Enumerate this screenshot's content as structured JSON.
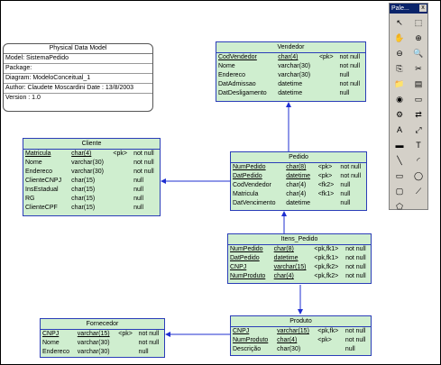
{
  "model_box": {
    "title": "Physical Data Model",
    "rows": [
      "Model: SistemaPedido",
      "Package:",
      "Diagram: ModeloConceitual_1",
      "Author: Claudete Moscardini   Date : 13/8/2003",
      "Version : 1.0"
    ]
  },
  "palette": {
    "title": "Pale...",
    "close": "x",
    "tools": [
      {
        "name": "pointer-icon",
        "glyph": "↖"
      },
      {
        "name": "select-area-icon",
        "glyph": "⬚"
      },
      {
        "name": "hand-icon",
        "glyph": "✋"
      },
      {
        "name": "zoom-in-icon",
        "glyph": "⊕"
      },
      {
        "name": "zoom-out-icon",
        "glyph": "⊖"
      },
      {
        "name": "zoom-fit-icon",
        "glyph": "🔍"
      },
      {
        "name": "copy-icon",
        "glyph": "⎘"
      },
      {
        "name": "cut-icon",
        "glyph": "✂"
      },
      {
        "name": "package-icon",
        "glyph": "📁"
      },
      {
        "name": "table-icon",
        "glyph": "▤"
      },
      {
        "name": "view-icon",
        "glyph": "◉"
      },
      {
        "name": "procedure-icon",
        "glyph": "▭"
      },
      {
        "name": "gear-icon",
        "glyph": "⚙"
      },
      {
        "name": "reference-icon",
        "glyph": "⇄"
      },
      {
        "name": "text-icon",
        "glyph": "A"
      },
      {
        "name": "link-icon",
        "glyph": "⤢"
      },
      {
        "name": "file-icon",
        "glyph": "▬"
      },
      {
        "name": "note-icon",
        "glyph": "T"
      },
      {
        "name": "line-icon",
        "glyph": "╲"
      },
      {
        "name": "arc-icon",
        "glyph": "◜"
      },
      {
        "name": "rectangle-icon",
        "glyph": "▭"
      },
      {
        "name": "ellipse-icon",
        "glyph": "◯"
      },
      {
        "name": "rounded-rect-icon",
        "glyph": "▢"
      },
      {
        "name": "polyline-icon",
        "glyph": "⟋"
      },
      {
        "name": "polygon-icon",
        "glyph": "⬠"
      }
    ]
  },
  "entities": {
    "vendedor": {
      "title": "Vendedor",
      "rows": [
        [
          "CodVendedor",
          "char(4)",
          "<pk>",
          "not null"
        ],
        [
          "Nome",
          "varchar(30)",
          "",
          "not null"
        ],
        [
          "Endereco",
          "varchar(30)",
          "",
          "null"
        ],
        [
          "DatAdmissao",
          "datetime",
          "",
          "not null"
        ],
        [
          "DatDesligamento",
          "datetime",
          "",
          "null"
        ]
      ]
    },
    "cliente": {
      "title": "Cliente",
      "rows": [
        [
          "Matricula",
          "char(4)",
          "<pk>",
          "not null"
        ],
        [
          "Nome",
          "varchar(30)",
          "",
          "not null"
        ],
        [
          "Endereco",
          "varchar(30)",
          "",
          "not null"
        ],
        [
          "ClienteCNPJ",
          "char(15)",
          "",
          "null"
        ],
        [
          "InsEstadual",
          "char(15)",
          "",
          "null"
        ],
        [
          "RG",
          "char(15)",
          "",
          "null"
        ],
        [
          "ClienteCPF",
          "char(15)",
          "",
          "null"
        ]
      ]
    },
    "pedido": {
      "title": "Pedido",
      "rows": [
        [
          "NumPedido",
          "char(8)",
          "<pk>",
          "not null"
        ],
        [
          "DatPedido",
          "datetime",
          "<pk>",
          "not null"
        ],
        [
          "CodVendedor",
          "char(4)",
          "<fk2>",
          "null"
        ],
        [
          "Matricula",
          "char(4)",
          "<fk1>",
          "null"
        ],
        [
          "DatVencimento",
          "datetime",
          "",
          "null"
        ]
      ]
    },
    "itens_pedido": {
      "title": "Itens_Pedido",
      "rows": [
        [
          "NumPedido",
          "char(8)",
          "<pk,fk1>",
          "not null"
        ],
        [
          "DatPedido",
          "datetime",
          "<pk,fk1>",
          "not null"
        ],
        [
          "CNPJ",
          "varchar(15)",
          "<pk,fk2>",
          "not null"
        ],
        [
          "NumProduto",
          "char(4)",
          "<pk,fk2>",
          "not null"
        ]
      ]
    },
    "fornecedor": {
      "title": "Fornecedor",
      "rows": [
        [
          "CNPJ",
          "varchar(15)",
          "<pk>",
          "not null"
        ],
        [
          "Nome",
          "varchar(30)",
          "",
          "not null"
        ],
        [
          "Endereco",
          "varchar(30)",
          "",
          "null"
        ]
      ]
    },
    "produto": {
      "title": "Produto",
      "rows": [
        [
          "CNPJ",
          "varchar(15)",
          "<pk,fk>",
          "not null"
        ],
        [
          "NumProduto",
          "char(4)",
          "<pk>",
          "not null"
        ],
        [
          "Descrição",
          "char(30)",
          "",
          "null"
        ]
      ]
    }
  },
  "colors": {
    "entity_fill": "#cfeecf",
    "entity_border": "#2b3db8",
    "link": "#1f2fd1"
  }
}
